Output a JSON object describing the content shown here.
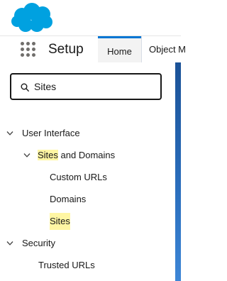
{
  "header": {
    "logo_icon": "cloud-logo-icon",
    "brand_color": "#00a1e0"
  },
  "nav": {
    "app_launcher_icon": "app-launcher-grid-icon",
    "app_name": "Setup",
    "tabs": [
      {
        "label": "Home",
        "active": true
      },
      {
        "label": "Object M"
      }
    ],
    "accent_color": "#0176d3"
  },
  "search": {
    "icon": "search-icon",
    "value": "Sites",
    "highlight_color": "#fff6a3"
  },
  "tree": {
    "user_interface": {
      "label": "User Interface",
      "expanded": true,
      "sites_and_domains": {
        "label_highlight": "Sites",
        "label_rest": " and Domains",
        "expanded": true,
        "children": [
          {
            "label": "Custom URLs"
          },
          {
            "label": "Domains"
          },
          {
            "label": "Sites",
            "highlighted": true
          }
        ]
      }
    },
    "security": {
      "label": "Security",
      "expanded": true,
      "children": [
        {
          "label": "Trusted URLs"
        }
      ]
    }
  }
}
